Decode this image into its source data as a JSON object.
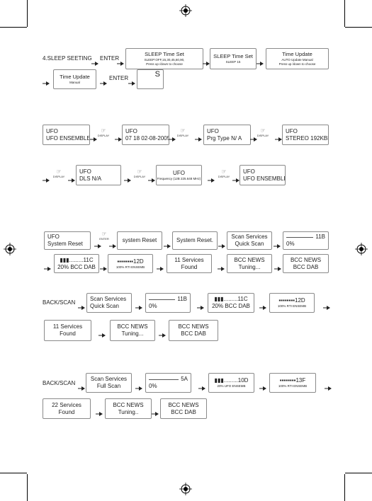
{
  "sleep_setting": {
    "lead": "4.SLEEP SEETING",
    "enter": "ENTER",
    "boxes": [
      {
        "lines": [
          "SLEEP Time Set",
          "SLEEP:OFF,15,30,45,60,90,",
          "Press up /down to choose"
        ]
      },
      {
        "lines": [
          "SLEEP  Time Set",
          "SLEEP  15"
        ]
      },
      {
        "lines": [
          "Time Update",
          "AUTO Update Manual",
          "Press up /down to choose"
        ]
      },
      {
        "lines": [
          "Time Update",
          "Manual"
        ]
      },
      {
        "lines": [
          "S"
        ]
      }
    ]
  },
  "display_cycle": {
    "button": "DISPLAY",
    "boxes": [
      {
        "lines": [
          "UFO",
          "UFO ENSEMBLE"
        ]
      },
      {
        "lines": [
          "UFO",
          "07 18 02-08-2005"
        ]
      },
      {
        "lines": [
          "UFO",
          "Prg Type N/ A"
        ]
      },
      {
        "lines": [
          "UFO",
          "STEREO 192KBPS"
        ]
      },
      {
        "lines": [
          "UFO",
          "DLS N/A"
        ]
      },
      {
        "lines": [
          "UFO",
          "Frequency (12B 225.648 MHz)"
        ]
      },
      {
        "lines": [
          "UFO",
          "UFO ENSEMBLE"
        ]
      }
    ]
  },
  "system_reset": {
    "button": "ENTER",
    "boxes": [
      {
        "lines": [
          "UFO",
          "System Reset"
        ]
      },
      {
        "lines": [
          "system Reset"
        ]
      },
      {
        "lines": [
          "System Reset."
        ]
      },
      {
        "lines": [
          "Scan Services",
          "Quick Scan"
        ]
      },
      {
        "lines": [
          "11B",
          "0%"
        ]
      },
      {
        "lines": [
          "▮▮▮.........11C",
          "20% BCC DAB"
        ]
      },
      {
        "lines": [
          "▪▪▪▪▪▪▪▪12D",
          "100% RTI ENSEMB"
        ]
      },
      {
        "lines": [
          "11 Services",
          "Found"
        ]
      },
      {
        "lines": [
          "BCC NEWS",
          "Tuning..."
        ]
      },
      {
        "lines": [
          "BCC NEWS",
          "BCC DAB"
        ]
      }
    ]
  },
  "quick_scan": {
    "lead": "BACK/SCAN",
    "boxes": [
      {
        "lines": [
          "Scan Services",
          "Quick Scan"
        ]
      },
      {
        "lines": [
          "11B",
          "0%"
        ]
      },
      {
        "lines": [
          "▮▮▮.........11C",
          "20% BCC DAB"
        ]
      },
      {
        "lines": [
          "▪▪▪▪▪▪▪▪12D",
          "100% RTI ENSEMB"
        ]
      },
      {
        "lines": [
          "11 Services",
          "Found"
        ]
      },
      {
        "lines": [
          "BCC NEWS",
          "Tuning..."
        ]
      },
      {
        "lines": [
          "BCC NEWS",
          "BCC DAB"
        ]
      }
    ]
  },
  "full_scan": {
    "lead": "BACK/SCAN",
    "boxes": [
      {
        "lines": [
          "Scan Services",
          "Full Scan"
        ]
      },
      {
        "lines": [
          "5A",
          "0%"
        ]
      },
      {
        "lines": [
          "▮▮▮.........10D",
          "20% UFO ENSEMB"
        ]
      },
      {
        "lines": [
          "▪▪▪▪▪▪▪▪13F",
          "100% RTI ENSEMB"
        ]
      },
      {
        "lines": [
          "22 Services",
          "Found"
        ]
      },
      {
        "lines": [
          "BCC NEWS",
          "Tuning.."
        ]
      },
      {
        "lines": [
          "BCC NEWS",
          "BCC DAB"
        ]
      }
    ]
  },
  "icons": {
    "hand": "pointing-hand-icon",
    "arrow": "right-arrow-icon",
    "registration": "registration-mark-icon"
  }
}
